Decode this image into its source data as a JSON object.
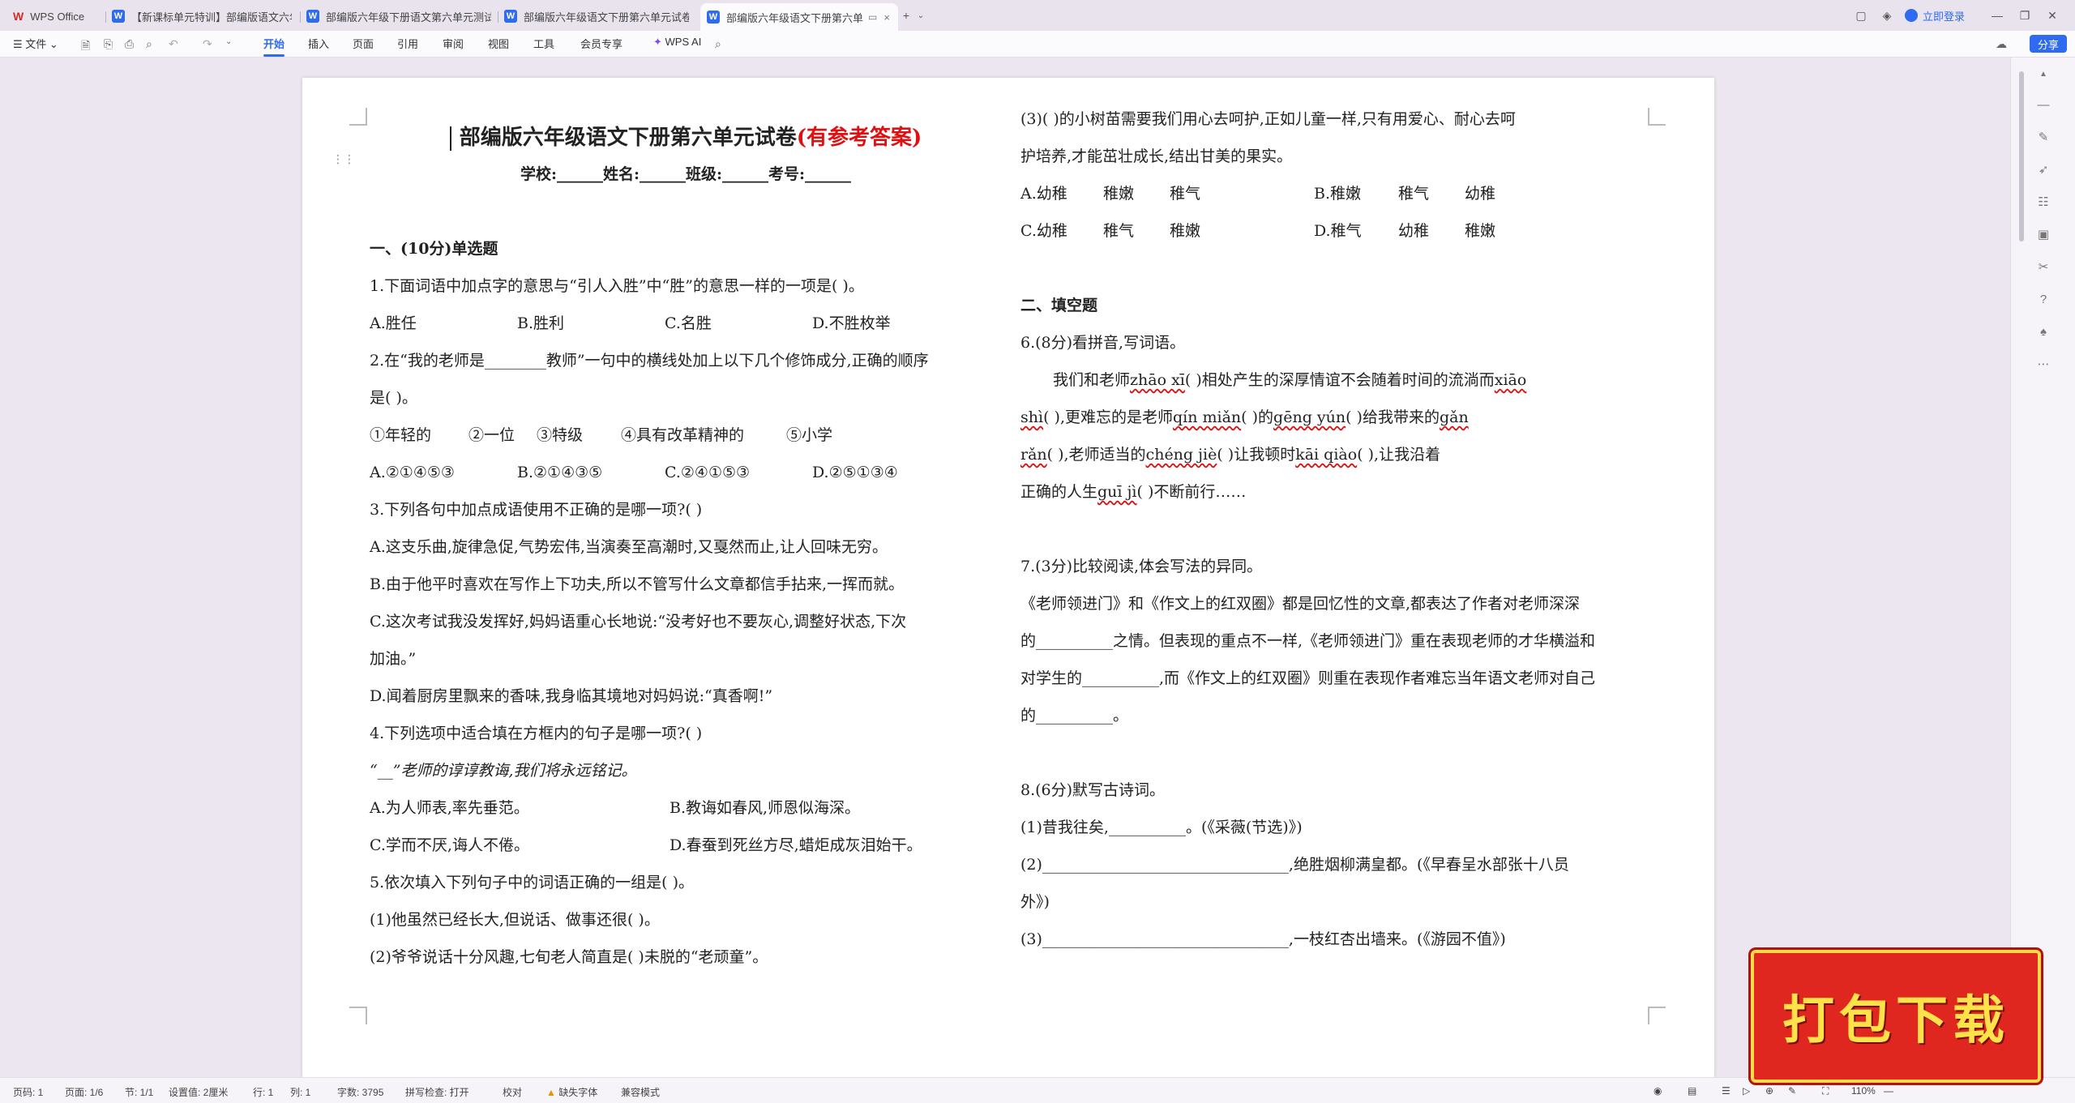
{
  "tabs": {
    "home": "WPS Office",
    "t1": "【新课标单元特训】部编版语文六年",
    "t2": "部编版六年级下册语文第六单元测试",
    "t3": "部编版六年级语文下册第六单元试卷",
    "t4": "部编版六年级语文下册第六单"
  },
  "window": {
    "login": "立即登录",
    "share": "分享"
  },
  "menu": {
    "file": "文件",
    "items": [
      "开始",
      "插入",
      "页面",
      "引用",
      "审阅",
      "视图",
      "工具",
      "会员专享"
    ],
    "ai": "WPS AI"
  },
  "doc": {
    "title": "部编版六年级语文下册第六单元试卷",
    "title_hl": "(有参考答案)",
    "subtitle": "学校:______姓名:______班级:______考号:______",
    "sec1": "一、(10分)单选题",
    "q1": "1.下面词语中加点字的意思与“引人入胜”中“胜”的意思一样的一项是(          )。",
    "q1_opts": [
      "A.胜任",
      "B.胜利",
      "C.名胜",
      "D.不胜枚举"
    ],
    "q2a": "2.在“我的老师是________教师”一句中的横线处加上以下几个修饰成分,正确的顺序",
    "q2b": "是(          )。",
    "q2_items": [
      "①年轻的",
      "②一位",
      "③特级",
      "④具有改革精神的",
      "⑤小学"
    ],
    "q2_opts": [
      "A.②①④⑤③",
      "B.②①④③⑤",
      "C.②④①⑤③",
      "D.②⑤①③④"
    ],
    "q3": "3.下列各句中加点成语使用不正确的是哪一项?(          )",
    "q3a": "A.这支乐曲,旋律急促,气势宏伟,当演奏至高潮时,又戛然而止,让人回味无穷。",
    "q3b": "B.由于他平时喜欢在写作上下功夫,所以不管写什么文章都信手拈来,一挥而就。",
    "q3c1": "C.这次考试我没发挥好,妈妈语重心长地说:“没考好也不要灰心,调整好状态,下次",
    "q3c2": "加油。”",
    "q3d": "D.闻着厨房里飘来的香味,我身临其境地对妈妈说:“真香啊!”",
    "q4": "4.下列选项中适合填在方框内的句子是哪一项?(          )",
    "q4_quote": "“__”老师的谆谆教诲,我们将永远铭记。",
    "q4_opts": [
      "A.为人师表,率先垂范。",
      "B.教诲如春风,师恩似海深。",
      "C.学而不厌,诲人不倦。",
      "D.春蚕到死丝方尽,蜡炬成灰泪始干。"
    ],
    "q5": "5.依次填入下列句子中的词语正确的一组是(          )。",
    "q5_1": "(1)他虽然已经长大,但说话、做事还很(          )。",
    "q5_2": "(2)爷爷说话十分风趣,七旬老人简直是(          )未脱的“老顽童”。",
    "q5_3a": "(3)(          )的小树苗需要我们用心去呵护,正如儿童一样,只有用爱心、耐心去呵",
    "q5_3b": "护培养,才能茁壮成长,结出甘美的果实。",
    "q5_opts": [
      [
        "A.幼稚",
        "稚嫩",
        "稚气"
      ],
      [
        "B.稚嫩",
        "稚气",
        "幼稚"
      ],
      [
        "C.幼稚",
        "稚气",
        "稚嫩"
      ],
      [
        "D.稚气",
        "幼稚",
        "稚嫩"
      ]
    ],
    "sec2": "二、填空题",
    "q6": "6.(8分)看拼音,写词语。",
    "q6_l1_a": "我们和老师",
    "q6_p1": "zhāo xī",
    "q6_l1_b": "(          )相处产生的深厚情谊不会随着时间的流淌而",
    "q6_p2": "xiāo",
    "q6_p2b": "shì",
    "q6_l2_a": "(          ),更难忘的是老师",
    "q6_p3": "qín miǎn",
    "q6_l2_b": "(          )的",
    "q6_p4": "gēng yún",
    "q6_l2_c": "(          )给我带来的",
    "q6_p5": "gǎn",
    "q6_p5b": "rǎn",
    "q6_l3_a": "(          ),老师适当的",
    "q6_p6": "chéng jiè",
    "q6_l3_b": "(          )让我顿时",
    "q6_p7": "kāi qiào",
    "q6_l3_c": "(          ),让我沿着",
    "q6_l4_a": "正确的人生",
    "q6_p8": "guī jì",
    "q6_l4_b": "(          )不断前行……",
    "q7": "7.(3分)比较阅读,体会写法的异同。",
    "q7_l1": "《老师领进门》和《作文上的红双圈》都是回忆性的文章,都表达了作者对老师深深",
    "q7_l2": "的__________之情。但表现的重点不一样,《老师领进门》重在表现老师的才华横溢和",
    "q7_l3": "对学生的__________,而《作文上的红双圈》则重在表现作者难忘当年语文老师对自己",
    "q7_l4": "的__________。",
    "q8": "8.(6分)默写古诗词。",
    "q8_1": "(1)昔我往矣,__________。(《采薇(节选)》)",
    "q8_2a": "(2)________________________________,绝胜烟柳满皇都。(《早春呈水部张十八员",
    "q8_2b": "外》)",
    "q8_3": "(3)________________________________,一枝红杏出墙来。(《游园不值》)"
  },
  "status": {
    "page": "页码: 1",
    "pages": "页面: 1/6",
    "section": "节: 1/1",
    "setting": "设置值: 2厘米",
    "row": "行: 1",
    "col": "列: 1",
    "words": "字数: 3795",
    "spell": "拼写检查: 打开",
    "proof": "校对",
    "missing_font": "缺失字体",
    "compat": "兼容模式",
    "zoom": "110%"
  },
  "badge": "打包下载",
  "colors": {
    "accent": "#2e6bf0",
    "title_red": "#dd1111",
    "badge_bg": "#e0271f",
    "badge_text": "#ffe14a"
  }
}
